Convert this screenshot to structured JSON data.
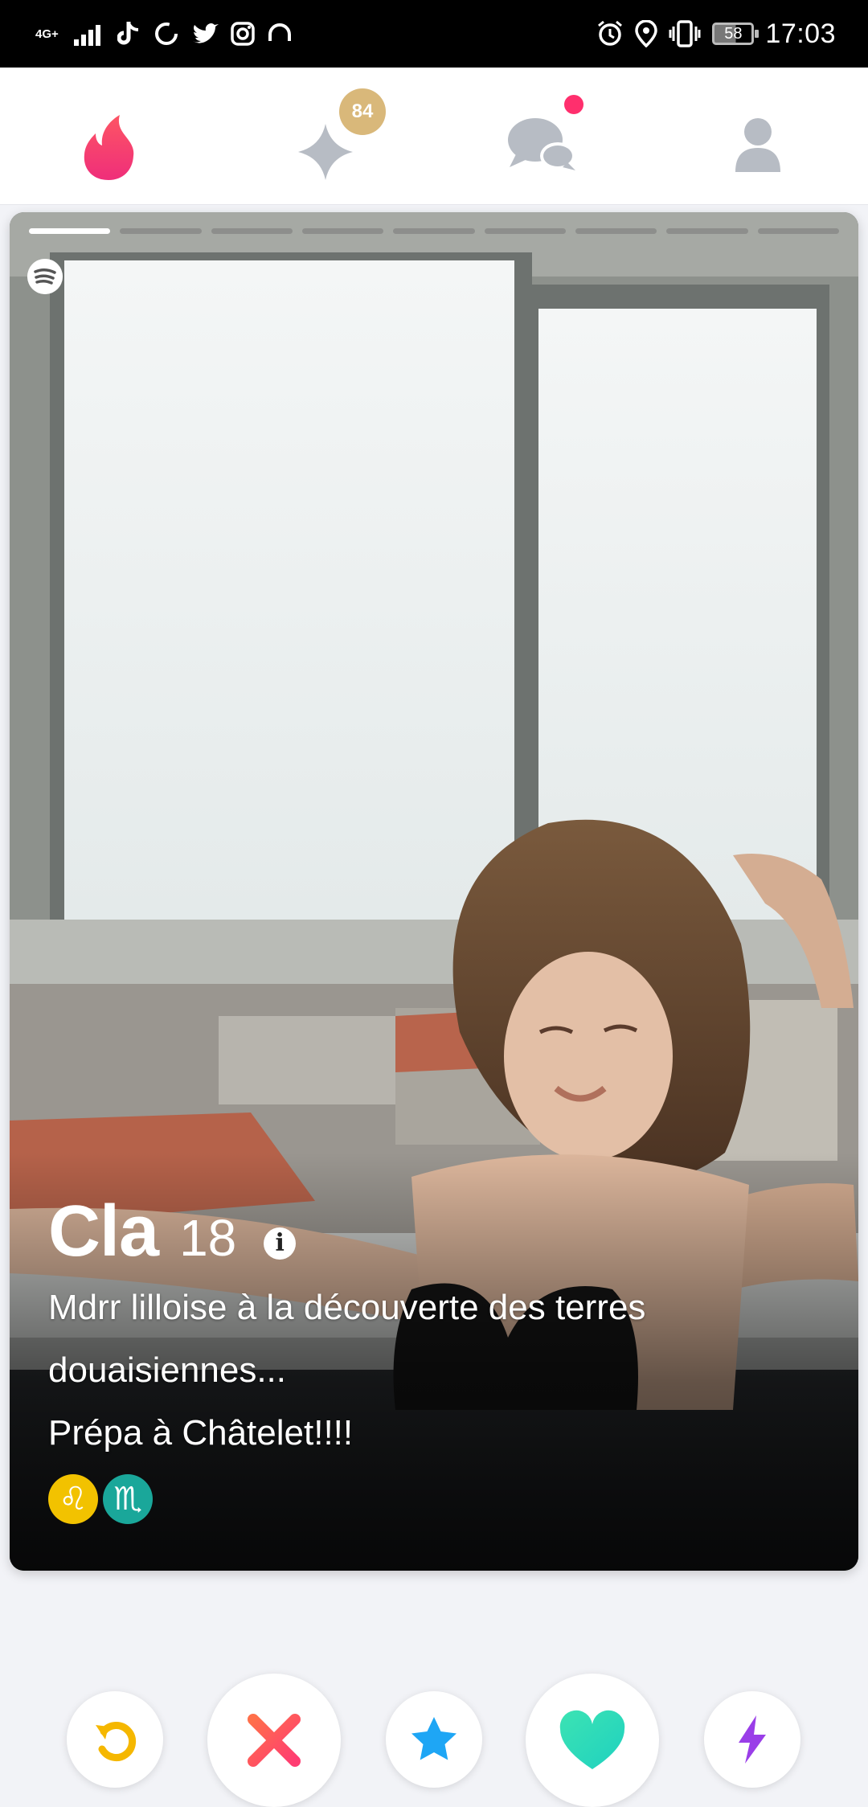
{
  "status_bar": {
    "network": "4G+",
    "time": "17:03",
    "battery": "58",
    "left_icons": [
      "signal-icon",
      "tiktok-icon",
      "sync-icon",
      "twitter-icon",
      "instagram-icon",
      "headphones-icon"
    ],
    "right_icons": [
      "alarm-icon",
      "location-icon",
      "vibrate-icon",
      "battery-icon"
    ]
  },
  "top_nav": {
    "items": [
      {
        "name": "tinder-flame",
        "icon": "flame-icon",
        "active": true,
        "color": "#fe3c72"
      },
      {
        "name": "gold-likes",
        "icon": "sparkle-icon",
        "badge": "84",
        "badge_color": "#d9b87a"
      },
      {
        "name": "messages",
        "icon": "chat-bubbles-icon",
        "has_new": true
      },
      {
        "name": "profile",
        "icon": "person-icon"
      }
    ]
  },
  "card": {
    "photo_count": 9,
    "active_photo": 1,
    "spotify_icon": "spotify-icon",
    "name": "Cla",
    "age": "18",
    "info_icon_label": "i",
    "bio": "Mdrr lilloise à la découverte des terres\ndouaisiennes...\nPrépa à Châtelet!!!!",
    "zodiac": [
      {
        "name": "leo",
        "symbol": "♌"
      },
      {
        "name": "scorpio",
        "symbol": "♏"
      }
    ]
  },
  "actions": [
    {
      "name": "rewind",
      "icon": "rewind-icon",
      "color": "#f5b700"
    },
    {
      "name": "nope",
      "icon": "close-icon",
      "color": "#fe4a6a"
    },
    {
      "name": "super-like",
      "icon": "star-icon",
      "color": "#1ea6f5"
    },
    {
      "name": "like",
      "icon": "heart-icon",
      "color": "#2de0b3"
    },
    {
      "name": "boost",
      "icon": "lightning-icon",
      "color": "#9a3ee8"
    }
  ]
}
